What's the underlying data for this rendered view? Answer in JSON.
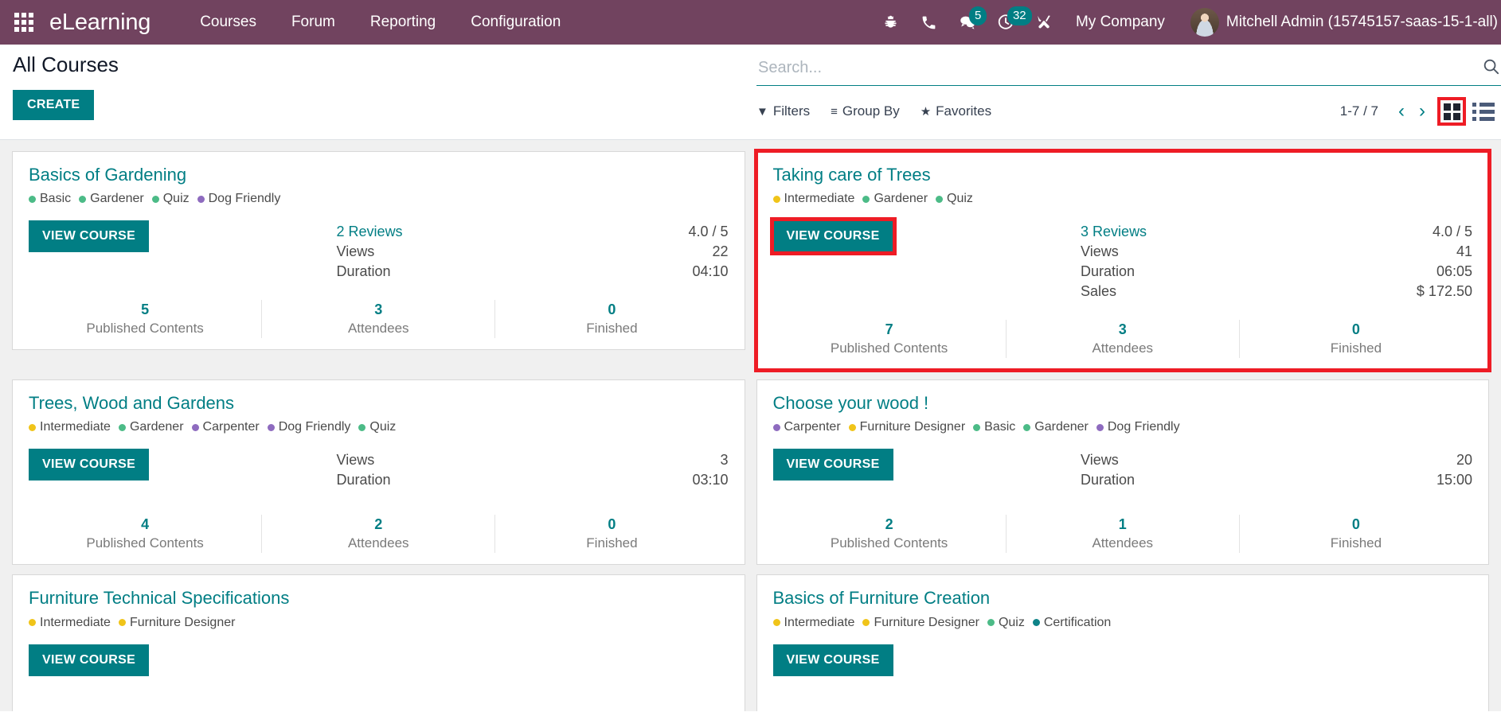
{
  "navbar": {
    "apps_icon": "apps-grid-icon",
    "brand": "eLearning",
    "menus": [
      "Courses",
      "Forum",
      "Reporting",
      "Configuration"
    ],
    "sys_icons": [
      {
        "name": "bug-icon",
        "badge": null
      },
      {
        "name": "phone-icon",
        "badge": null
      },
      {
        "name": "messages-icon",
        "badge": "5"
      },
      {
        "name": "activities-clock-icon",
        "badge": "32"
      },
      {
        "name": "tools-icon",
        "badge": null
      }
    ],
    "company": "My Company",
    "username": "Mitchell Admin (15745157-saas-15-1-all)"
  },
  "control_panel": {
    "title": "All Courses",
    "create_label": "CREATE",
    "search": {
      "value": "",
      "placeholder": "Search..."
    },
    "filters": [
      {
        "icon": "funnel-icon",
        "glyph": "▼",
        "label": "Filters"
      },
      {
        "icon": "group-by-icon",
        "glyph": "≡",
        "label": "Group By"
      },
      {
        "icon": "star-icon",
        "glyph": "★",
        "label": "Favorites"
      }
    ],
    "pager": "1-7 / 7",
    "prev": "‹",
    "next": "›",
    "views": [
      {
        "name": "kanban",
        "active": true
      },
      {
        "name": "list",
        "active": false
      }
    ]
  },
  "colors": {
    "brand_purple": "#71435F",
    "teal": "#017E84",
    "highlight_red": "#EE1C25",
    "tag_green": "#4CBB87",
    "tag_yellow": "#F0C419",
    "tag_purple": "#8E6BBF",
    "tag_teal": "#0E8388"
  },
  "footer_captions": {
    "published": "Published Contents",
    "attendees": "Attendees",
    "finished": "Finished"
  },
  "courses": [
    {
      "title": "Basics of Gardening",
      "tags": [
        {
          "label": "Basic",
          "color": "#4CBB87"
        },
        {
          "label": "Gardener",
          "color": "#4CBB87"
        },
        {
          "label": "Quiz",
          "color": "#4CBB87"
        },
        {
          "label": "Dog Friendly",
          "color": "#8E6BBF"
        }
      ],
      "button": "VIEW COURSE",
      "selected": false,
      "button_selected": false,
      "stats": [
        {
          "label": "2 Reviews",
          "link": true,
          "value": "4.0 / 5"
        },
        {
          "label": "Views",
          "link": false,
          "value": "22"
        },
        {
          "label": "Duration",
          "link": false,
          "value": "04:10"
        }
      ],
      "footer": [
        {
          "num": "5",
          "cap": "Published Contents"
        },
        {
          "num": "3",
          "cap": "Attendees"
        },
        {
          "num": "0",
          "cap": "Finished"
        }
      ]
    },
    {
      "title": "Taking care of Trees",
      "tags": [
        {
          "label": "Intermediate",
          "color": "#F0C419"
        },
        {
          "label": "Gardener",
          "color": "#4CBB87"
        },
        {
          "label": "Quiz",
          "color": "#4CBB87"
        }
      ],
      "button": "VIEW COURSE",
      "selected": true,
      "button_selected": true,
      "stats": [
        {
          "label": "3 Reviews",
          "link": true,
          "value": "4.0 / 5"
        },
        {
          "label": "Views",
          "link": false,
          "value": "41"
        },
        {
          "label": "Duration",
          "link": false,
          "value": "06:05"
        },
        {
          "label": "Sales",
          "link": false,
          "value": "$ 172.50"
        }
      ],
      "footer": [
        {
          "num": "7",
          "cap": "Published Contents"
        },
        {
          "num": "3",
          "cap": "Attendees"
        },
        {
          "num": "0",
          "cap": "Finished"
        }
      ]
    },
    {
      "title": "Trees, Wood and Gardens",
      "tags": [
        {
          "label": "Intermediate",
          "color": "#F0C419"
        },
        {
          "label": "Gardener",
          "color": "#4CBB87"
        },
        {
          "label": "Carpenter",
          "color": "#8E6BBF"
        },
        {
          "label": "Dog Friendly",
          "color": "#8E6BBF"
        },
        {
          "label": "Quiz",
          "color": "#4CBB87"
        }
      ],
      "button": "VIEW COURSE",
      "selected": false,
      "button_selected": false,
      "stats": [
        {
          "label": "Views",
          "link": false,
          "value": "3"
        },
        {
          "label": "Duration",
          "link": false,
          "value": "03:10"
        }
      ],
      "footer": [
        {
          "num": "4",
          "cap": "Published Contents"
        },
        {
          "num": "2",
          "cap": "Attendees"
        },
        {
          "num": "0",
          "cap": "Finished"
        }
      ]
    },
    {
      "title": "Choose your wood !",
      "tags": [
        {
          "label": "Carpenter",
          "color": "#8E6BBF"
        },
        {
          "label": "Furniture Designer",
          "color": "#F0C419"
        },
        {
          "label": "Basic",
          "color": "#4CBB87"
        },
        {
          "label": "Gardener",
          "color": "#4CBB87"
        },
        {
          "label": "Dog Friendly",
          "color": "#8E6BBF"
        }
      ],
      "button": "VIEW COURSE",
      "selected": false,
      "button_selected": false,
      "stats": [
        {
          "label": "Views",
          "link": false,
          "value": "20"
        },
        {
          "label": "Duration",
          "link": false,
          "value": "15:00"
        }
      ],
      "footer": [
        {
          "num": "2",
          "cap": "Published Contents"
        },
        {
          "num": "1",
          "cap": "Attendees"
        },
        {
          "num": "0",
          "cap": "Finished"
        }
      ]
    },
    {
      "title": "Furniture Technical Specifications",
      "tags": [
        {
          "label": "Intermediate",
          "color": "#F0C419"
        },
        {
          "label": "Furniture Designer",
          "color": "#F0C419"
        }
      ],
      "button": "VIEW COURSE",
      "selected": false,
      "button_selected": false,
      "stats": [],
      "footer": []
    },
    {
      "title": "Basics of Furniture Creation",
      "tags": [
        {
          "label": "Intermediate",
          "color": "#F0C419"
        },
        {
          "label": "Furniture Designer",
          "color": "#F0C419"
        },
        {
          "label": "Quiz",
          "color": "#4CBB87"
        },
        {
          "label": "Certification",
          "color": "#0E8388"
        }
      ],
      "button": "VIEW COURSE",
      "selected": false,
      "button_selected": false,
      "stats": [],
      "footer": []
    }
  ]
}
